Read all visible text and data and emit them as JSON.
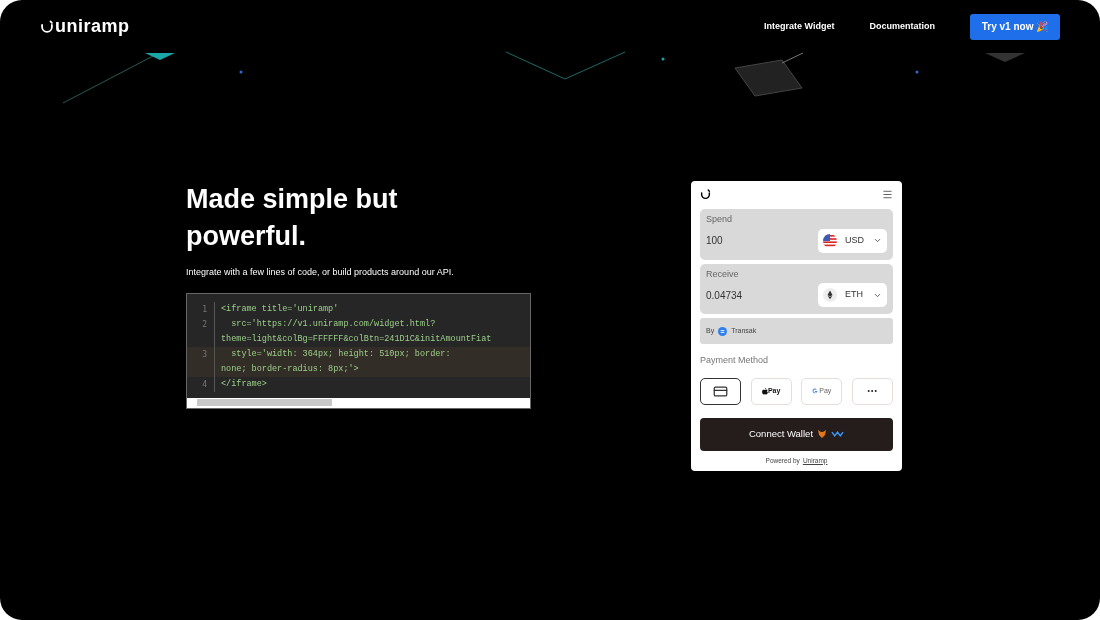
{
  "nav": {
    "logo": "uniramp",
    "links": [
      {
        "label": "Integrate Widget"
      },
      {
        "label": "Documentation"
      }
    ],
    "cta": "Try v1 now 🎉"
  },
  "hero": {
    "title": "Made simple but powerful.",
    "subtitle": "Integrate with a few lines of code, or build products around our API."
  },
  "code": {
    "lines": [
      {
        "number": "1",
        "active": false,
        "text": "<iframe title='uniramp'"
      },
      {
        "number": "2",
        "active": false,
        "text": "  src='https://v1.uniramp.com/widget.html?\ntheme=light&colBg=FFFFFF&colBtn=241D1C&initAmountFiat"
      },
      {
        "number": "3",
        "active": true,
        "text": "  style='width: 364px; height: 510px; border:\nnone; border-radius: 8px;'>"
      },
      {
        "number": "4",
        "active": false,
        "text": "</iframe>"
      }
    ]
  },
  "widget": {
    "spend": {
      "label": "Spend",
      "value": "100",
      "currency": "USD"
    },
    "receive": {
      "label": "Receive",
      "value": "0.04734",
      "currency": "ETH"
    },
    "provider": {
      "prefix": "By",
      "name": "Transak"
    },
    "payment_label": "Payment Method",
    "payment_methods": [
      {
        "kind": "card",
        "selected": true
      },
      {
        "kind": "apple",
        "label": "Pay",
        "selected": false
      },
      {
        "kind": "google",
        "label": "Pay",
        "selected": false
      },
      {
        "kind": "more",
        "selected": false
      }
    ],
    "connect": "Connect Wallet",
    "powered": {
      "prefix": "Powered by",
      "link": "Uniramp"
    }
  }
}
